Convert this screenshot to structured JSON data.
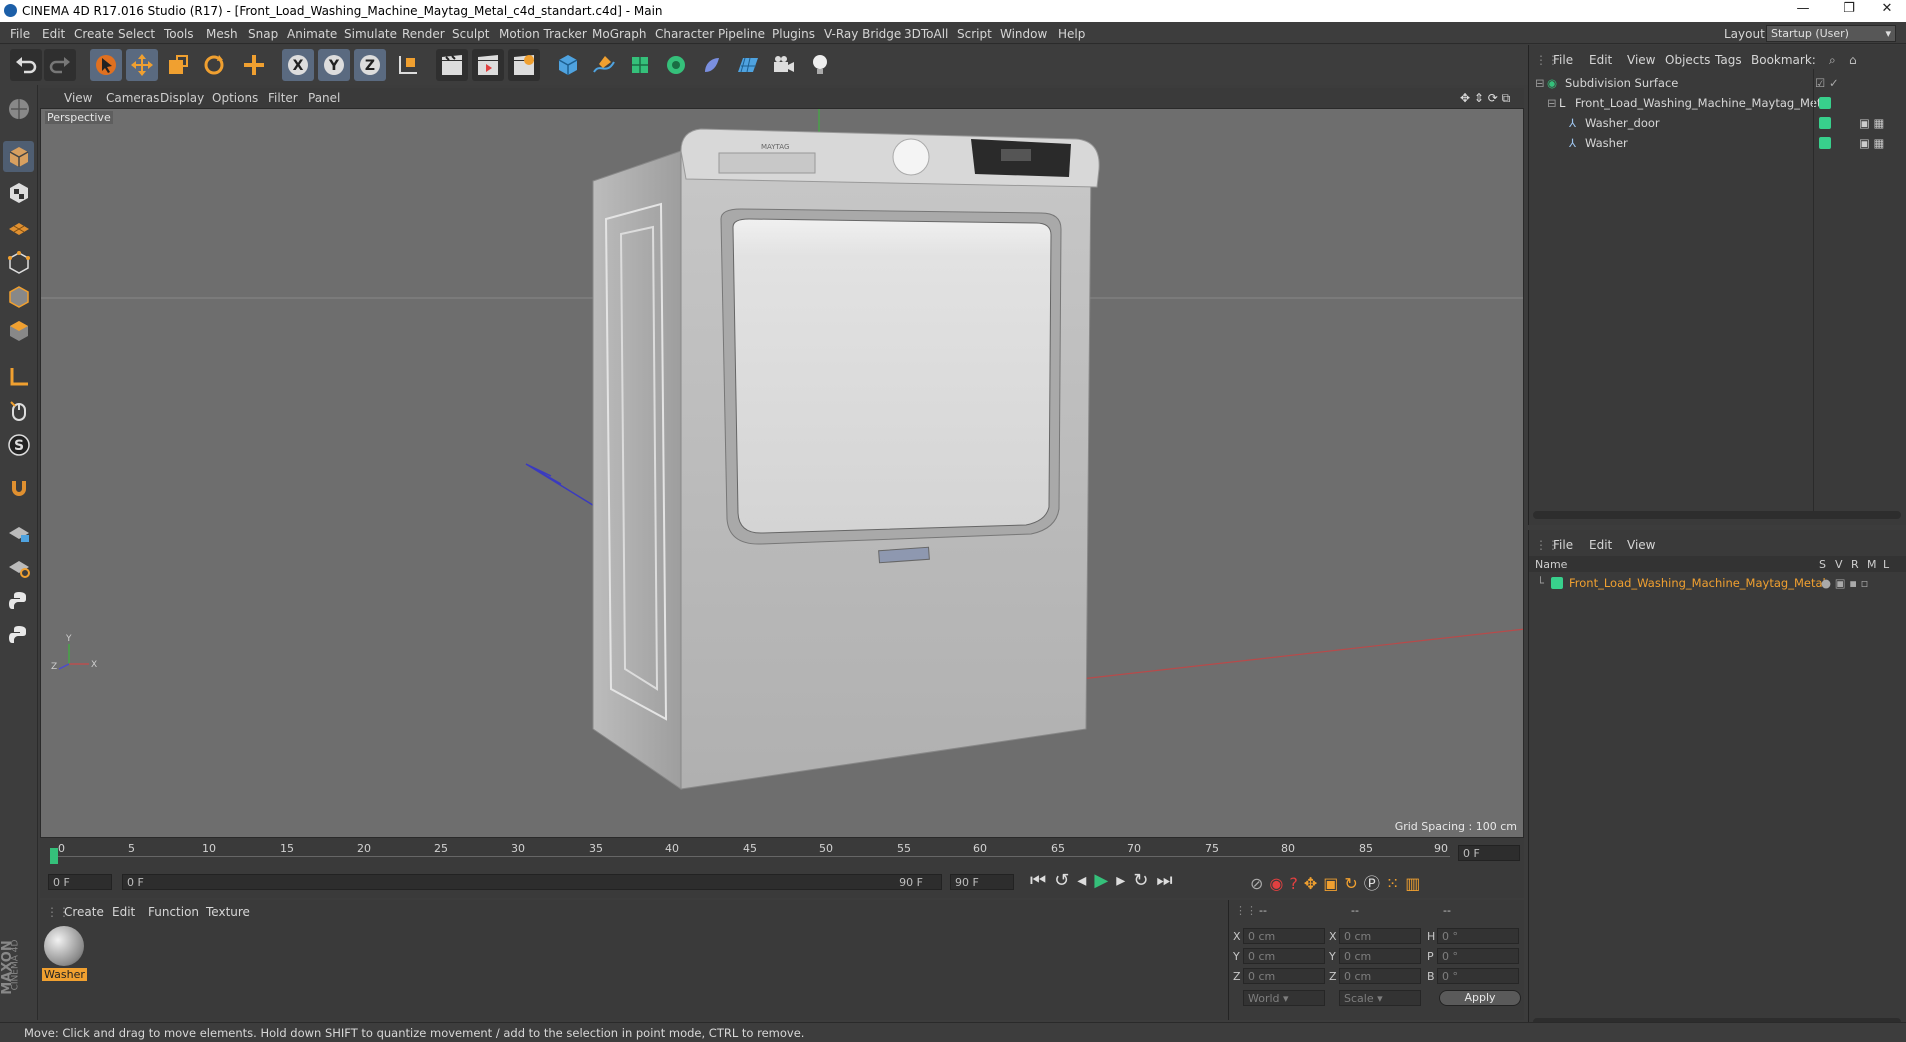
{
  "window": {
    "title": "CINEMA 4D R17.016 Studio (R17) - [Front_Load_Washing_Machine_Maytag_Metal_c4d_standart.c4d] - Main",
    "controls": [
      "—",
      "❐",
      "✕"
    ]
  },
  "menubar": {
    "items": [
      "File",
      "Edit",
      "Create",
      "Select",
      "Tools",
      "Mesh",
      "Snap",
      "Animate",
      "Simulate",
      "Render",
      "Sculpt",
      "Motion Tracker",
      "MoGraph",
      "Character",
      "Pipeline",
      "Plugins",
      "V-Ray Bridge",
      "3DToAll",
      "Script",
      "Window",
      "Help"
    ],
    "layout_label": "Layout:",
    "layout_value": "Startup (User)"
  },
  "viewport": {
    "menu": [
      "View",
      "Cameras",
      "Display",
      "Options",
      "Filter",
      "Panel"
    ],
    "label": "Perspective",
    "grid_spacing": "Grid Spacing : 100 cm"
  },
  "object_manager": {
    "menu": [
      "File",
      "Edit",
      "View",
      "Objects",
      "Tags",
      "Bookmark:"
    ],
    "objects": [
      {
        "name": "Subdivision Surface"
      },
      {
        "name": "Front_Load_Washing_Machine_Maytag_Metal"
      },
      {
        "name": "Washer_door"
      },
      {
        "name": "Washer"
      }
    ]
  },
  "attribute_manager": {
    "menu": [
      "File",
      "Edit",
      "View"
    ],
    "columns": [
      "Name",
      "S",
      "V",
      "R",
      "M",
      "L"
    ],
    "layer_name": "Front_Load_Washing_Machine_Maytag_Metal",
    "accent": "#f0a030"
  },
  "timeline": {
    "ticks": [
      "0",
      "5",
      "10",
      "15",
      "20",
      "25",
      "30",
      "35",
      "40",
      "45",
      "50",
      "55",
      "60",
      "65",
      "70",
      "75",
      "80",
      "85",
      "90"
    ],
    "current_frame": "0 F",
    "start_field": "0 F",
    "range_start": "0 F",
    "range_end": "90 F",
    "end_field": "90 F"
  },
  "material_manager": {
    "menu": [
      "Create",
      "Edit",
      "Function",
      "Texture"
    ],
    "material_name": "Washer"
  },
  "coordinates": {
    "headers": [
      "--",
      "--",
      "--"
    ],
    "rows": [
      {
        "a": "X",
        "av": "0 cm",
        "b": "X",
        "bv": "0 cm",
        "c": "H",
        "cv": "0 °"
      },
      {
        "a": "Y",
        "av": "0 cm",
        "b": "Y",
        "bv": "0 cm",
        "c": "P",
        "cv": "0 °"
      },
      {
        "a": "Z",
        "av": "0 cm",
        "b": "Z",
        "bv": "0 cm",
        "c": "B",
        "cv": "0 °"
      }
    ],
    "mode": "World",
    "transform": "Scale",
    "apply": "Apply"
  },
  "status": {
    "text": "Move: Click and drag to move elements. Hold down SHIFT to quantize movement / add to the selection in point mode, CTRL to remove."
  },
  "brand": {
    "line1": "MAXON",
    "line2": "CINEMA 4D"
  }
}
